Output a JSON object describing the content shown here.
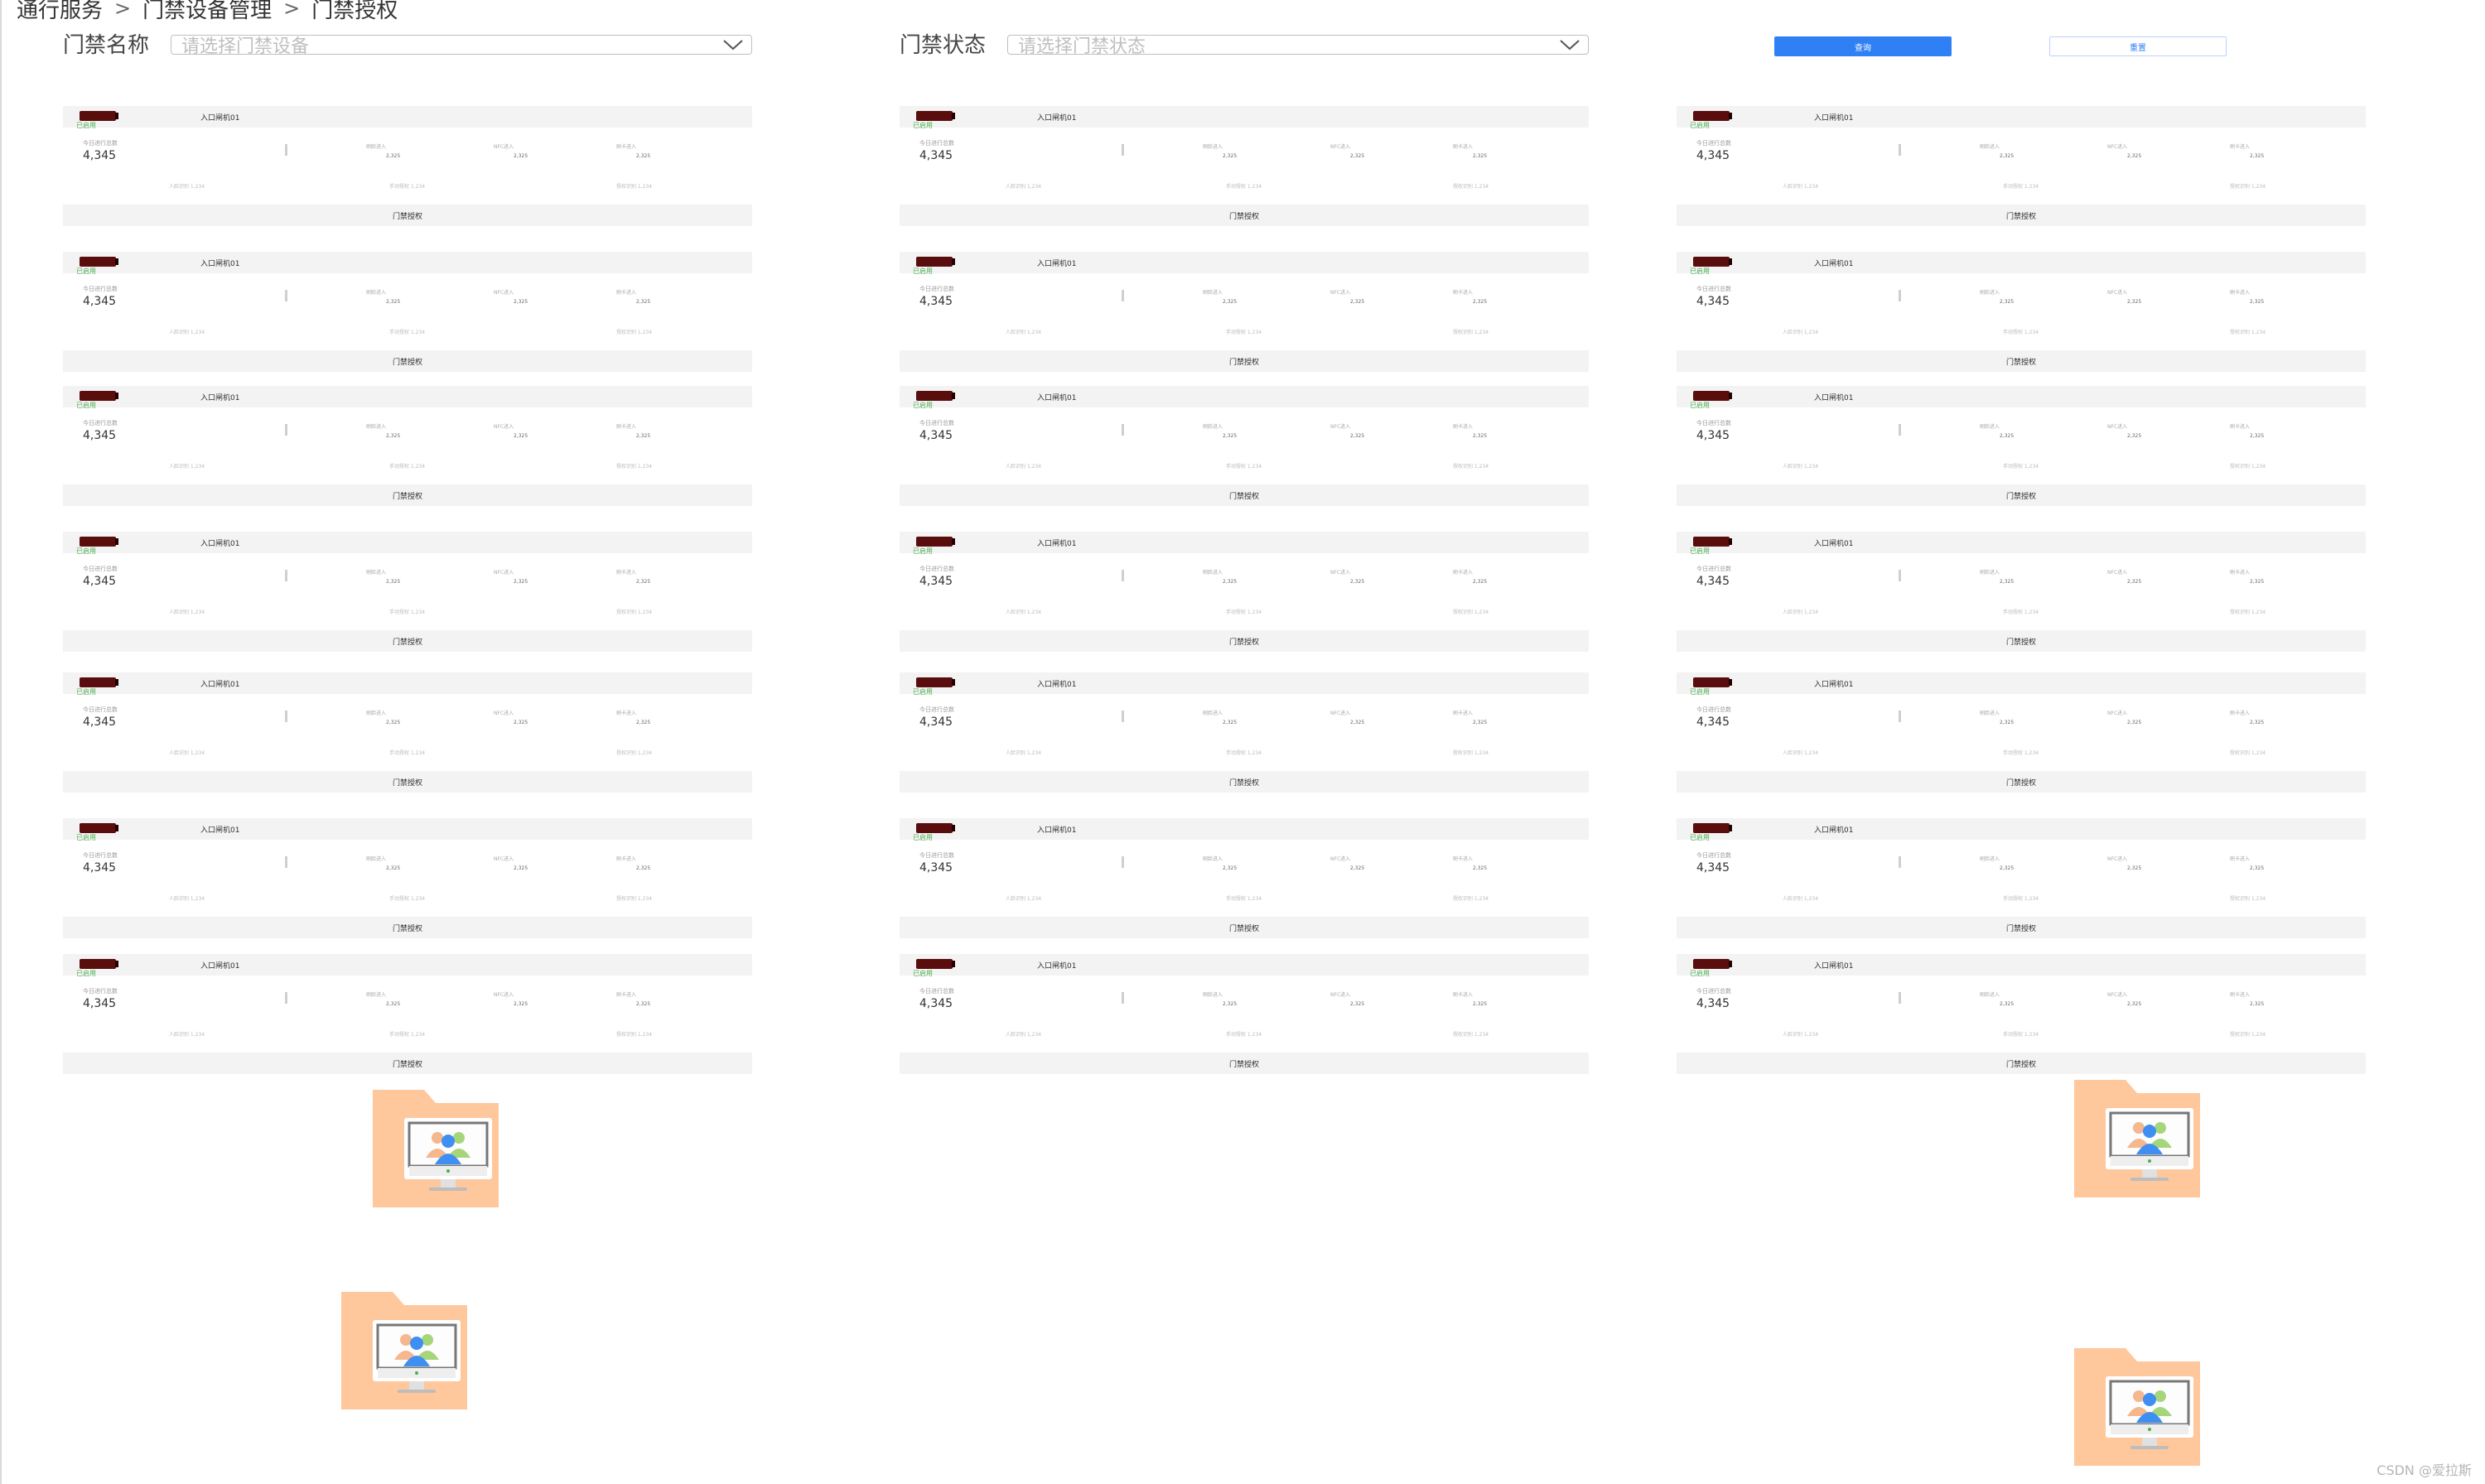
{
  "breadcrumb": [
    "通行服务",
    "门禁设备管理",
    "门禁授权"
  ],
  "filters": {
    "name_label": "门禁名称",
    "name_placeholder": "请选择门禁设备",
    "status_label": "门禁状态",
    "status_placeholder": "请选择门禁状态",
    "query_button": "查询",
    "reset_button": "重置"
  },
  "card": {
    "status": "已启用",
    "device_name": "入口闸机01",
    "today_label": "今日进行总数",
    "today_value": "4,345",
    "metrics": [
      {
        "label": "刷脸进入",
        "value": "2,325"
      },
      {
        "label": "NFC进入",
        "value": "2,325"
      },
      {
        "label": "刷卡进入",
        "value": "2,325"
      }
    ],
    "sub_metrics": [
      {
        "label": "人脸识别 1,234"
      },
      {
        "label": "手动授权 1,234"
      },
      {
        "label": "授权识别 1,234"
      }
    ],
    "footer": "门禁授权"
  },
  "colors": {
    "primary": "#2f7ff5",
    "status_green": "#4caf50",
    "card_bg": "#f3f3f3",
    "folder": "#ffc79c"
  },
  "watermark": "CSDN @爱拉斯"
}
